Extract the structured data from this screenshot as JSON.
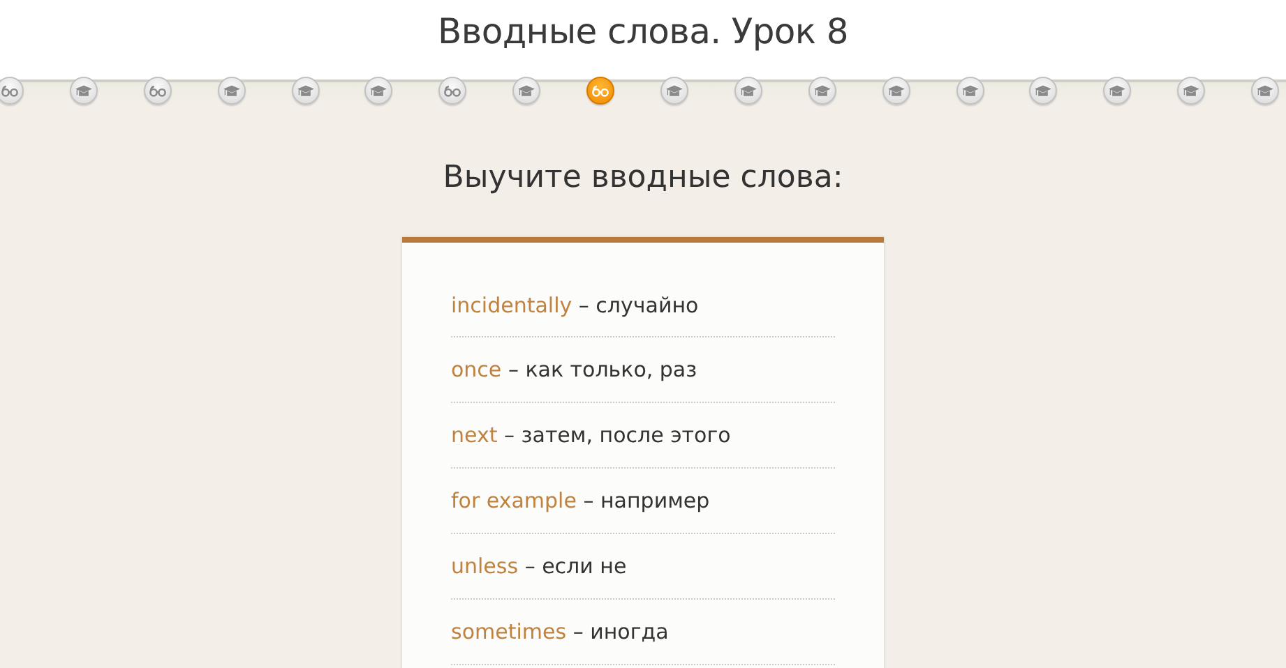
{
  "title": "Вводные слова. Урок 8",
  "steps": [
    {
      "kind": "glasses",
      "selected": false
    },
    {
      "kind": "cap",
      "selected": false
    },
    {
      "kind": "glasses",
      "selected": false
    },
    {
      "kind": "cap",
      "selected": false
    },
    {
      "kind": "cap",
      "selected": false
    },
    {
      "kind": "cap",
      "selected": false
    },
    {
      "kind": "glasses",
      "selected": false
    },
    {
      "kind": "cap",
      "selected": false
    },
    {
      "kind": "glasses",
      "selected": true
    },
    {
      "kind": "cap",
      "selected": false
    },
    {
      "kind": "cap",
      "selected": false
    },
    {
      "kind": "cap",
      "selected": false
    },
    {
      "kind": "cap",
      "selected": false
    },
    {
      "kind": "cap",
      "selected": false
    },
    {
      "kind": "cap",
      "selected": false
    },
    {
      "kind": "cap",
      "selected": false
    },
    {
      "kind": "cap",
      "selected": false
    },
    {
      "kind": "cap",
      "selected": false
    }
  ],
  "subtitle": "Выучите вводные слова:",
  "words": [
    {
      "word": "incidentally",
      "translation": "– случайно"
    },
    {
      "word": "once",
      "translation": "– как только, раз"
    },
    {
      "word": "next",
      "translation": "– затем, после этого"
    },
    {
      "word": "for example",
      "translation": "– например"
    },
    {
      "word": "unless",
      "translation": "– если не"
    },
    {
      "word": "sometimes",
      "translation": "– иногда"
    }
  ]
}
